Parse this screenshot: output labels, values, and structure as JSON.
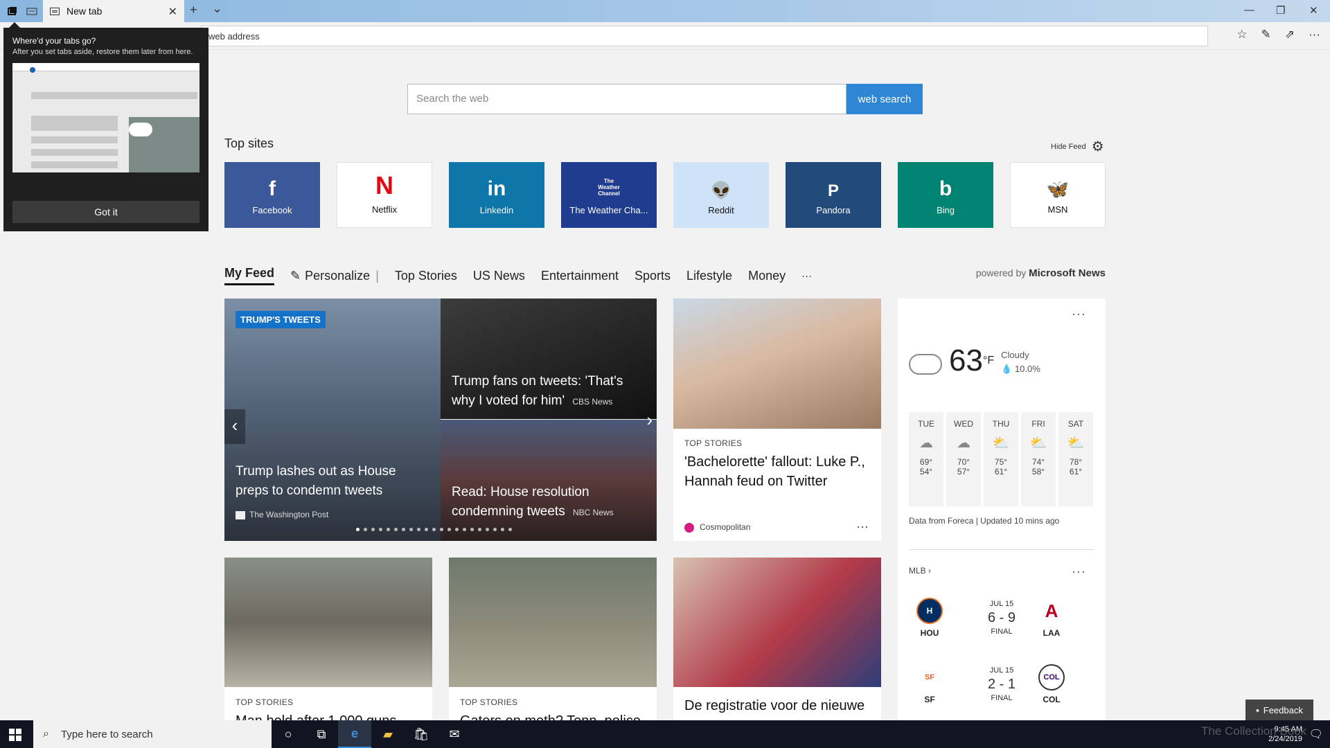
{
  "browser": {
    "tab_title": "New tab",
    "address_placeholder": "web address",
    "new_tab_symbol": "+",
    "tab_list_symbol": "⌄",
    "close_symbol": "✕"
  },
  "tabs_aside_popup": {
    "title": "Where'd your tabs go?",
    "body": "After you set tabs aside, restore them later from here.",
    "button": "Got it"
  },
  "search": {
    "placeholder": "Search the web",
    "button": "web search"
  },
  "top_sites": {
    "label": "Top sites",
    "hide_feed": "Hide Feed",
    "sites": [
      {
        "name": "Facebook",
        "glyph": "f",
        "color": "#3b5998"
      },
      {
        "name": "Netflix",
        "glyph": "N",
        "color": "#e50914"
      },
      {
        "name": "Linkedin",
        "glyph": "in",
        "color": "#0e76a8"
      },
      {
        "name": "The Weather Cha...",
        "glyph": "The Weather Channel",
        "color": "#1f3c8f"
      },
      {
        "name": "Reddit",
        "glyph": "👽",
        "color": "#cee3f8"
      },
      {
        "name": "Pandora",
        "glyph": "P",
        "color": "#224a7a"
      },
      {
        "name": "Bing",
        "glyph": "b",
        "color": "#008373"
      },
      {
        "name": "MSN",
        "glyph": "🦋",
        "color": "#ffffff"
      }
    ]
  },
  "feed_nav": {
    "items": [
      "My Feed",
      "Personalize",
      "Top Stories",
      "US News",
      "Entertainment",
      "Sports",
      "Lifestyle",
      "Money",
      "···"
    ],
    "powered_by": "powered by",
    "powered_brand": "Microsoft News"
  },
  "hero": {
    "tag": "TRUMP'S TWEETS",
    "main_headline": "Trump lashes out as House preps to condemn tweets",
    "main_source": "The Washington Post",
    "top_right_headline": "Trump fans on tweets: 'That's why I voted for him'",
    "top_right_source": "CBS News",
    "bottom_right_headline": "Read: House resolution condemning tweets",
    "bottom_right_source": "NBC News"
  },
  "cards": [
    {
      "kicker": "TOP STORIES",
      "headline": "'Bachelorette' fallout: Luke P., Hannah feud on Twitter",
      "source": "Cosmopolitan"
    },
    {
      "kicker": "TOP STORIES",
      "headline": "Man held after 1,000 guns"
    },
    {
      "kicker": "TOP STORIES",
      "headline": "Gators on meth? Tenn. police"
    },
    {
      "kicker": "",
      "headline": "De registratie voor de nieuwe"
    }
  ],
  "weather": {
    "temp": "63",
    "unit": "°F",
    "condition": "Cloudy",
    "precip": "10.0%",
    "forecast": [
      {
        "day": "TUE",
        "hi": "69°",
        "lo": "54°",
        "icon": "cloud"
      },
      {
        "day": "WED",
        "hi": "70°",
        "lo": "57°",
        "icon": "cloud"
      },
      {
        "day": "THU",
        "hi": "75°",
        "lo": "61°",
        "icon": "partly-sunny"
      },
      {
        "day": "FRI",
        "hi": "74°",
        "lo": "58°",
        "icon": "partly-sunny"
      },
      {
        "day": "SAT",
        "hi": "78°",
        "lo": "61°",
        "icon": "partly-sunny"
      }
    ],
    "source": "Data from Foreca | Updated 10 mins ago"
  },
  "mlb": {
    "label": "MLB",
    "games": [
      {
        "away": "HOU",
        "home": "LAA",
        "date": "JUL 15",
        "score": "6 - 9",
        "status": "FINAL"
      },
      {
        "away": "SF",
        "home": "COL",
        "date": "JUL 15",
        "score": "2 - 1",
        "status": "FINAL"
      }
    ]
  },
  "feedback": "Feedback",
  "taskbar": {
    "search_placeholder": "Type here to search",
    "time": "9:45 AM",
    "date": "2/24/2019"
  },
  "watermark": "The Collection Book"
}
